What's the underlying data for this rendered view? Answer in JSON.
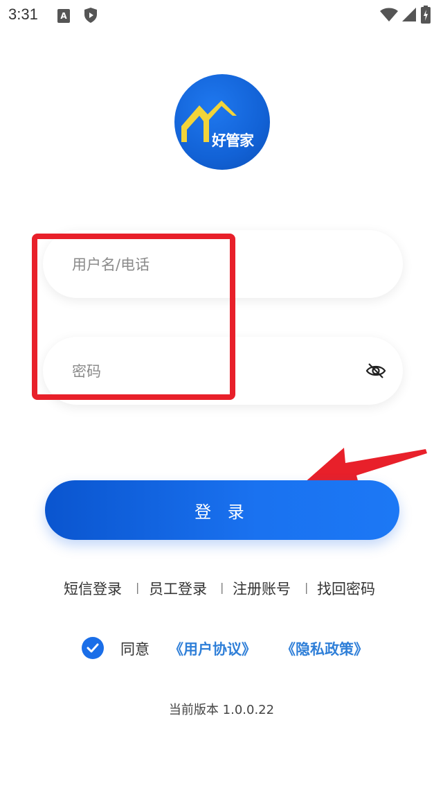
{
  "status_bar": {
    "time": "3:31",
    "icons": [
      "a-notification-icon",
      "shield-icon",
      "wifi-icon",
      "signal-icon",
      "battery-charging-icon"
    ]
  },
  "logo": {
    "text": "好管家",
    "brand_color": "#1262d6"
  },
  "form": {
    "username_placeholder": "用户名/电话",
    "password_placeholder": "密码",
    "password_toggle_icon": "eye-off-icon"
  },
  "login_button": {
    "label": "登 录",
    "color": "#1a6ee8"
  },
  "links": {
    "sms_login": "短信登录",
    "staff_login": "员工登录",
    "register": "注册账号",
    "find_password": "找回密码",
    "separator": "|"
  },
  "agreement": {
    "checked": true,
    "prefix": "同意",
    "user_agreement": "《用户协议》",
    "privacy_policy": "《隐私政策》",
    "link_color": "#2f7fd8"
  },
  "version": "当前版本 1.0.0.22",
  "annotation": {
    "color": "#e8202a"
  }
}
